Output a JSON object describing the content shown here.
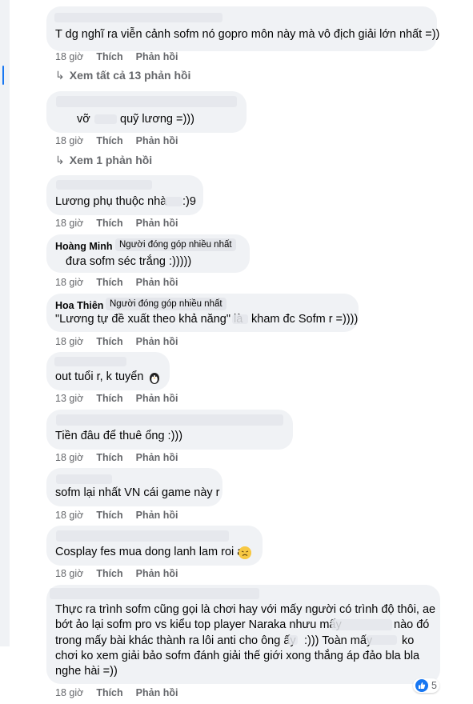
{
  "comments": [
    {
      "author": "",
      "badge": "",
      "text": "T dg nghĩ ra viễn cảnh sofm nó gopro môn này mà vô địch giải lớn nhất =))",
      "time": "18 giờ",
      "like": "Thích",
      "reply": "Phản hồi",
      "replies_link": "Xem tất cả 13 phản hồi"
    },
    {
      "author": "",
      "badge": "",
      "text_parts": [
        "vỡ",
        "quỹ lương =)))"
      ],
      "time": "18 giờ",
      "like": "Thích",
      "reply": "Phản hồi",
      "replies_link": "Xem 1 phản hồi"
    },
    {
      "author": "",
      "badge": "",
      "text_parts": [
        "Lương phụ thuộc nhà",
        ":)9"
      ],
      "time": "18 giờ",
      "like": "Thích",
      "reply": "Phản hồi"
    },
    {
      "author": "Hoàng Minh",
      "badge": "Người đóng góp nhiều nhất",
      "text": "đưa sofm séc trắng :)))))",
      "time": "18 giờ",
      "like": "Thích",
      "reply": "Phản hồi"
    },
    {
      "author": "Hoa Thiên",
      "badge": "Người đóng góp nhiều nhất",
      "text_parts": [
        "\"Lương tự đề xuất theo khả năng\" là",
        "kham đc Sofm r =))))"
      ],
      "time": "18 giờ",
      "like": "Thích",
      "reply": "Phản hồi"
    },
    {
      "author": "",
      "badge": "",
      "text": "out tuổi r, k tuyển",
      "emoji": "penguin-emoji",
      "time": "13 giờ",
      "like": "Thích",
      "reply": "Phản hồi"
    },
    {
      "author": "",
      "badge": "",
      "text": "Tiền đâu để thuê ổng :)))",
      "time": "18 giờ",
      "like": "Thích",
      "reply": "Phản hồi"
    },
    {
      "author": "",
      "badge": "",
      "text": "sofm lại nhất VN cái game này r",
      "time": "18 giờ",
      "like": "Thích",
      "reply": "Phản hồi"
    },
    {
      "author": "",
      "badge": "",
      "text": "Cosplay fes mua dong lanh lam roi a",
      "emoji": "tired-face-emoji",
      "time": "18 giờ",
      "like": "Thích",
      "reply": "Phản hồi"
    },
    {
      "author": "",
      "badge": "",
      "lines": [
        "Thực ra trình sofm cũng gọi là chơi hay với mấy người có trình độ thôi, ae",
        "bớt ảo lại sofm pro vs kiểu top player Naraka nhưu mấy",
        "nào đó",
        "trong mấy bài khác thành ra lôi anti cho ông ấy",
        ":))) Toàn mấy",
        "ko",
        "chơi ko xem giải bảo sofm đánh giải thế giới xong thắng áp đảo bla bla",
        "nghe hài =))"
      ],
      "time": "18 giờ",
      "like": "Thích",
      "reply": "Phản hồi",
      "reaction_icon": "like-icon",
      "reaction_count": "5"
    }
  ],
  "colors": {
    "bubble": "#f0f2f5",
    "secondary_text": "#65676b",
    "primary_text": "#050505",
    "like_blue": "#1877f2"
  }
}
